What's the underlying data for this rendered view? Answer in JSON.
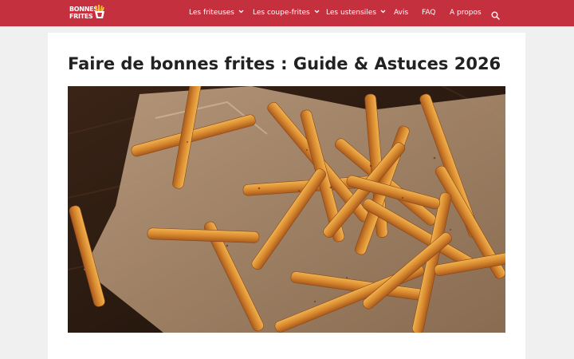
{
  "brand": {
    "logo_line1": "BONNES",
    "logo_line2": "FRITES",
    "accent": "#c4303d"
  },
  "nav": {
    "items": [
      {
        "label": "Les friteuses",
        "has_dropdown": true
      },
      {
        "label": "Les coupe-frites",
        "has_dropdown": true
      },
      {
        "label": "Les ustensiles",
        "has_dropdown": true
      },
      {
        "label": "Avis",
        "has_dropdown": false
      },
      {
        "label": "FAQ",
        "has_dropdown": false
      },
      {
        "label": "A propos",
        "has_dropdown": false
      }
    ],
    "search_icon": "search-icon"
  },
  "article": {
    "title": "Faire de bonnes frites : Guide & Astuces 2026",
    "hero_alt": "seasoned-fries-photo"
  }
}
